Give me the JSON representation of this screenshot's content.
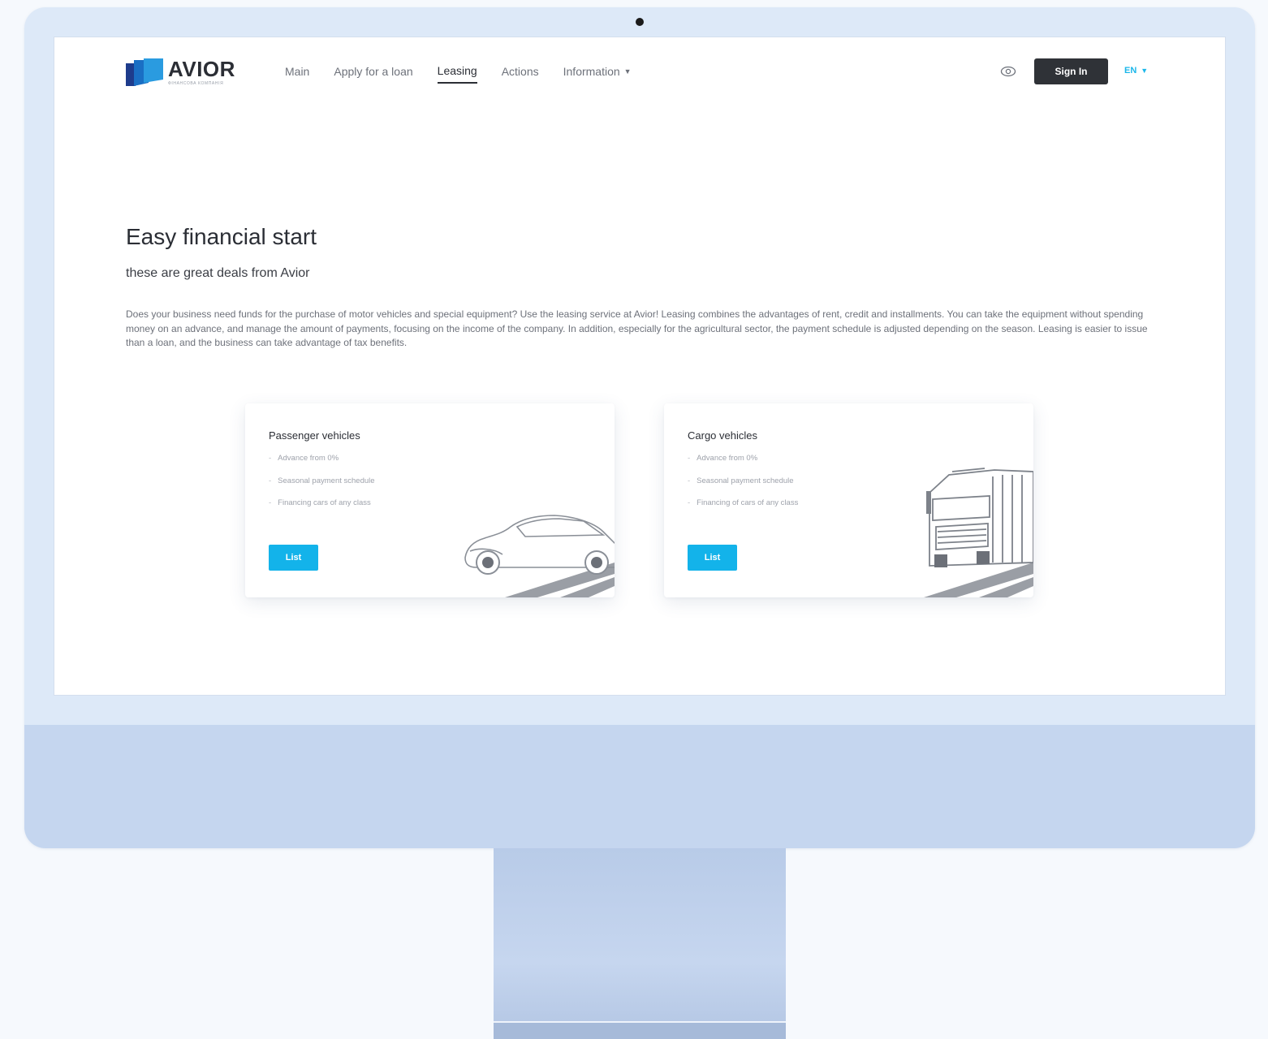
{
  "brand": {
    "name": "AVIOR",
    "tagline": "ФІНАНСОВА КОМПАНІЯ"
  },
  "nav": {
    "items": [
      {
        "label": "Main",
        "active": false
      },
      {
        "label": "Apply for a loan",
        "active": false
      },
      {
        "label": "Leasing",
        "active": true
      },
      {
        "label": "Actions",
        "active": false
      },
      {
        "label": "Information",
        "active": false,
        "dropdown": true
      }
    ]
  },
  "header": {
    "accessibility_icon": "eye-icon",
    "signin_label": "Sign In",
    "language": "EN"
  },
  "hero": {
    "title": "Easy financial start",
    "subtitle": "these are great deals from Avior",
    "description": "Does your business need funds for the purchase of motor vehicles and special equipment? Use the leasing service at Avior! Leasing combines the advantages of rent, credit and installments. You can take the equipment without spending money on an advance, and manage the amount of payments, focusing on the income of the company. In addition, especially for the agricultural sector, the payment schedule is adjusted depending on the season. Leasing is easier to issue than a loan, and the business can take advantage of tax benefits."
  },
  "cards": [
    {
      "title": "Passenger vehicles",
      "features": [
        "Advance from 0%",
        "Seasonal payment schedule",
        "Financing cars of any class"
      ],
      "button_label": "List",
      "illustration": "car-illustration"
    },
    {
      "title": "Cargo vehicles",
      "features": [
        "Advance from 0%",
        "Seasonal payment schedule",
        "Financing of cars of any class"
      ],
      "button_label": "List",
      "illustration": "truck-illustration"
    }
  ],
  "colors": {
    "accent": "#13b3ea",
    "dark": "#2f3237",
    "text": "#2b2e35",
    "muted": "#6d717a"
  }
}
